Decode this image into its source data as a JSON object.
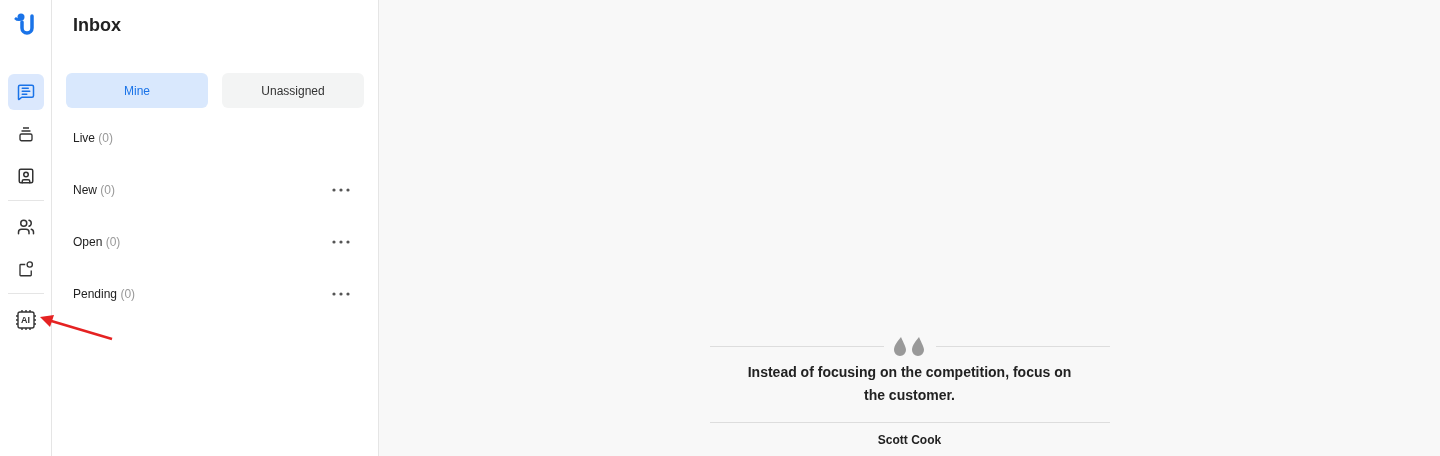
{
  "nav": {
    "groups": [
      [
        {
          "kind": "chat",
          "selected": true
        },
        {
          "kind": "stack",
          "selected": false
        },
        {
          "kind": "contact",
          "selected": false
        }
      ],
      [
        {
          "kind": "people",
          "selected": false
        },
        {
          "kind": "shape",
          "selected": false
        }
      ],
      [
        {
          "kind": "chip",
          "label": "AI",
          "selected": false
        }
      ]
    ]
  },
  "inbox": {
    "title": "Inbox",
    "tabs": [
      {
        "label": "Mine",
        "selected": true
      },
      {
        "label": "Unassigned",
        "selected": false
      }
    ],
    "folders": [
      {
        "name": "Live",
        "count": "(0)",
        "has_menu": false
      },
      {
        "name": "New",
        "count": "(0)",
        "has_menu": true
      },
      {
        "name": "Open",
        "count": "(0)",
        "has_menu": true
      },
      {
        "name": "Pending",
        "count": "(0)",
        "has_menu": true
      }
    ]
  },
  "quote": {
    "text": "Instead of focusing on the competition, focus on the customer.",
    "author": "Scott Cook"
  }
}
